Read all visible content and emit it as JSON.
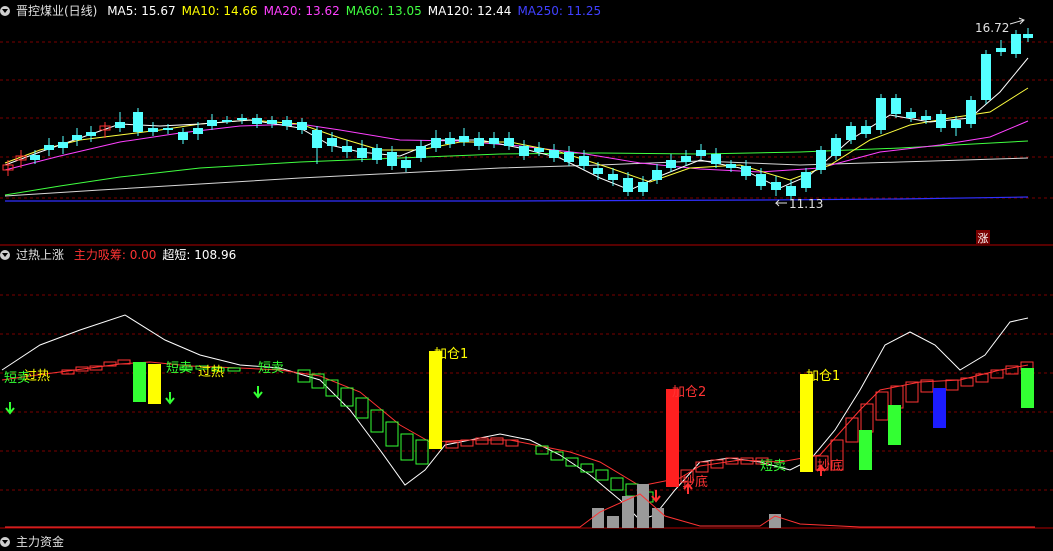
{
  "main_panel": {
    "title": "晋控煤业(日线)",
    "indicators": [
      {
        "label": "MA5: 15.67",
        "color": "#ffffff"
      },
      {
        "label": "MA10: 14.66",
        "color": "#ffff00"
      },
      {
        "label": "MA20: 13.62",
        "color": "#ff40ff"
      },
      {
        "label": "MA60: 13.05",
        "color": "#40ff40"
      },
      {
        "label": "MA120: 12.44",
        "color": "#ffffff"
      },
      {
        "label": "MA250: 11.25",
        "color": "#4040ff"
      }
    ],
    "high_label": "16.72",
    "low_label": "11.13",
    "badge": "涨"
  },
  "sub_panel": {
    "title": "过热上涨",
    "indicators": [
      {
        "label": "主力吸筹: 0.00",
        "color": "#ff3333"
      },
      {
        "label": "超短: 108.96",
        "color": "#ffffff"
      }
    ],
    "signals": [
      {
        "text": "短卖",
        "color": "#33ff33"
      },
      {
        "text": "过热",
        "color": "#ffff00"
      },
      {
        "text": "短卖",
        "color": "#33ff33"
      },
      {
        "text": "过热",
        "color": "#ffff00"
      },
      {
        "text": "短卖",
        "color": "#33ff33"
      },
      {
        "text": "加仓1",
        "color": "#ffff00"
      },
      {
        "text": "加仓2",
        "color": "#ff3333"
      },
      {
        "text": "抄底",
        "color": "#ff3333"
      },
      {
        "text": "短卖",
        "color": "#33ff33"
      },
      {
        "text": "加仓1",
        "color": "#ffff00"
      },
      {
        "text": "抄底",
        "color": "#ff3333"
      }
    ]
  },
  "bottom_panel": {
    "title": "主力资金"
  },
  "colors": {
    "up": "#ff3333",
    "down": "#54ffff",
    "grid": "#7a0000",
    "separator": "#b00000",
    "volume": "#9a9a9a"
  }
}
